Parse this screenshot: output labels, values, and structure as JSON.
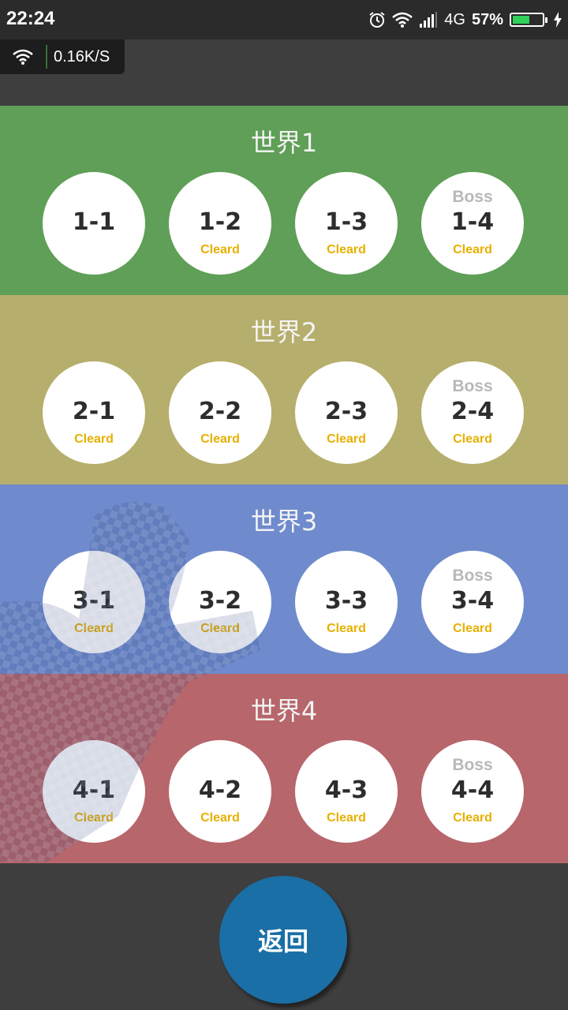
{
  "status_bar": {
    "time": "22:24",
    "network_label": "4G",
    "battery_percent": "57%",
    "battery_level": 0.57,
    "icons": [
      "alarm-icon",
      "wifi-icon",
      "signal-icon",
      "battery-charging-icon"
    ]
  },
  "net_speed": {
    "value": "0.16K/S",
    "icon": "wifi-icon"
  },
  "worlds": [
    {
      "title": "世界1",
      "color": "#5f9f57",
      "stages": [
        {
          "label": "1-1",
          "status": "",
          "boss": ""
        },
        {
          "label": "1-2",
          "status": "Cleard",
          "boss": ""
        },
        {
          "label": "1-3",
          "status": "Cleard",
          "boss": ""
        },
        {
          "label": "1-4",
          "status": "Cleard",
          "boss": "Boss"
        }
      ]
    },
    {
      "title": "世界2",
      "color": "#b6ae6c",
      "stages": [
        {
          "label": "2-1",
          "status": "Cleard",
          "boss": ""
        },
        {
          "label": "2-2",
          "status": "Cleard",
          "boss": ""
        },
        {
          "label": "2-3",
          "status": "Cleard",
          "boss": ""
        },
        {
          "label": "2-4",
          "status": "Cleard",
          "boss": "Boss"
        }
      ]
    },
    {
      "title": "世界3",
      "color": "#6f8bcd",
      "stages": [
        {
          "label": "3-1",
          "status": "Cleard",
          "boss": ""
        },
        {
          "label": "3-2",
          "status": "Cleard",
          "boss": ""
        },
        {
          "label": "3-3",
          "status": "Cleard",
          "boss": ""
        },
        {
          "label": "3-4",
          "status": "Cleard",
          "boss": "Boss"
        }
      ]
    },
    {
      "title": "世界4",
      "color": "#b7666b",
      "stages": [
        {
          "label": "4-1",
          "status": "Cleard",
          "boss": ""
        },
        {
          "label": "4-2",
          "status": "Cleard",
          "boss": ""
        },
        {
          "label": "4-3",
          "status": "Cleard",
          "boss": ""
        },
        {
          "label": "4-4",
          "status": "Cleard",
          "boss": "Boss"
        }
      ]
    }
  ],
  "back_button": {
    "label": "返回",
    "color": "#1a6fa6"
  }
}
